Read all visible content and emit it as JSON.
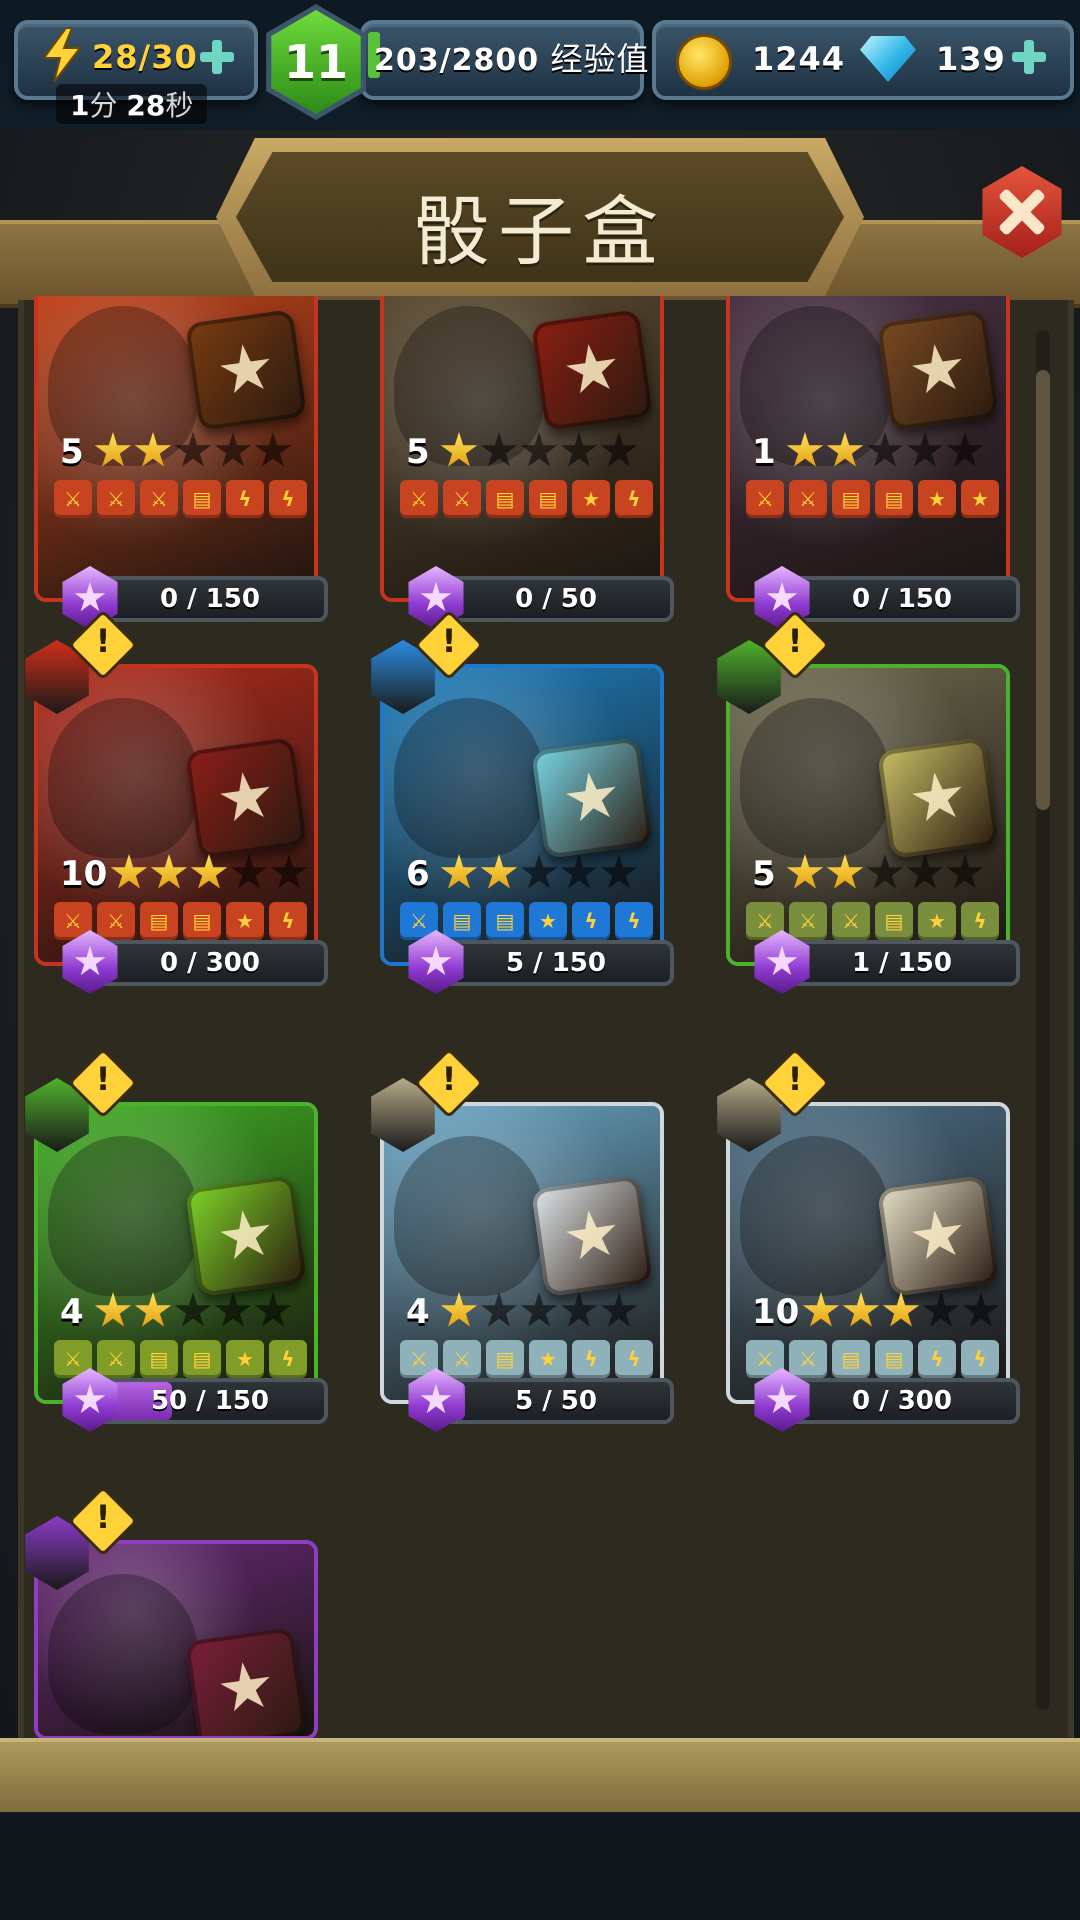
{
  "hud": {
    "energy": "28/30",
    "timer_min": "1",
    "timer_min_unit": "分",
    "timer_sec": "28",
    "timer_sec_unit": "秒",
    "level": "11",
    "xp": "203/2800",
    "xp_label": "经验值",
    "coins": "1244",
    "gems": "139"
  },
  "title": "骰子盒",
  "cards": [
    {
      "level": "5",
      "stars": 2,
      "progress": "0 / 150",
      "fill": 0.0,
      "theme": "#c2431a",
      "border": "#c6341f",
      "faces": [
        "⚔",
        "⚔",
        "⚔",
        "▤",
        "ϟ",
        "ϟ"
      ]
    },
    {
      "level": "5",
      "stars": 1,
      "progress": "0 / 50",
      "fill": 0.0,
      "theme": "#5b4a31",
      "border": "#c6341f",
      "faces": [
        "⚔",
        "⚔",
        "▤",
        "▤",
        "★",
        "ϟ"
      ]
    },
    {
      "level": "1",
      "stars": 2,
      "progress": "0 / 150",
      "fill": 0.0,
      "theme": "#4a3245",
      "border": "#c6341f",
      "faces": [
        "⚔",
        "⚔",
        "▤",
        "▤",
        "★",
        "★"
      ]
    },
    {
      "level": "10",
      "stars": 3,
      "progress": "0 / 300",
      "fill": 0.0,
      "theme": "#b32b1c",
      "border": "#c6341f",
      "faces": [
        "⚔",
        "⚔",
        "▤",
        "▤",
        "★",
        "ϟ"
      ]
    },
    {
      "level": "6",
      "stars": 2,
      "progress": "5 / 150",
      "fill": 0.033,
      "theme": "#1c7fbf",
      "border": "#1f77c9",
      "faces": [
        "⚔",
        "▤",
        "▤",
        "★",
        "ϟ",
        "ϟ"
      ]
    },
    {
      "level": "5",
      "stars": 2,
      "progress": "1 / 150",
      "fill": 0.007,
      "theme": "#6e6a4f",
      "border": "#49b32a",
      "faces": [
        "⚔",
        "⚔",
        "⚔",
        "▤",
        "★",
        "ϟ"
      ]
    },
    {
      "level": "4",
      "stars": 2,
      "progress": "50 / 150",
      "fill": 0.333,
      "theme": "#3fae22",
      "border": "#49b32a",
      "faces": [
        "⚔",
        "⚔",
        "▤",
        "▤",
        "★",
        "ϟ"
      ]
    },
    {
      "level": "4",
      "stars": 1,
      "progress": "5 / 50",
      "fill": 0.1,
      "theme": "#6aa8c9",
      "border": "#cfd8dc",
      "faces": [
        "⚔",
        "⚔",
        "▤",
        "★",
        "ϟ",
        "ϟ"
      ]
    },
    {
      "level": "10",
      "stars": 3,
      "progress": "0 / 300",
      "fill": 0.0,
      "theme": "#4c6f86",
      "border": "#cfd8dc",
      "faces": [
        "⚔",
        "⚔",
        "▤",
        "▤",
        "ϟ",
        "ϟ"
      ]
    },
    {
      "level": "",
      "stars": 0,
      "progress": "",
      "fill": 0.0,
      "theme": "#6a2a7a",
      "border": "#8f3dc1",
      "faces": []
    }
  ],
  "colors": {
    "face_red": "#c8431f",
    "face_blue": "#1f78d6",
    "face_green": "#7f9d28",
    "face_slate": "#8fb1b9",
    "face_olive": "#7a8f3d"
  }
}
